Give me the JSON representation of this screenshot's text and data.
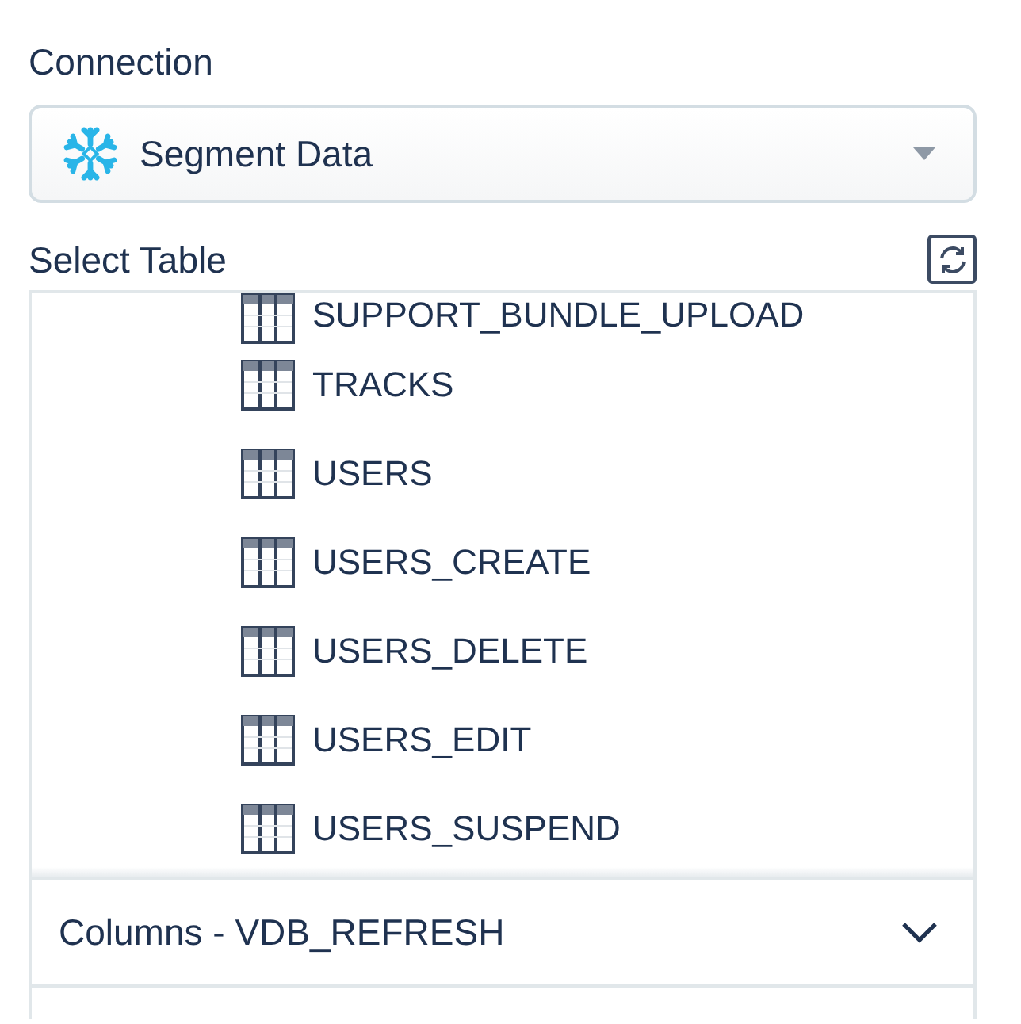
{
  "connection": {
    "label": "Connection",
    "value": "Segment Data"
  },
  "select_table": {
    "label": "Select Table",
    "tables": [
      {
        "name": "SUPPORT_BUNDLE_UPLOAD"
      },
      {
        "name": "TRACKS"
      },
      {
        "name": "USERS"
      },
      {
        "name": "USERS_CREATE"
      },
      {
        "name": "USERS_DELETE"
      },
      {
        "name": "USERS_EDIT"
      },
      {
        "name": "USERS_SUSPEND"
      }
    ]
  },
  "columns_panel": {
    "title": "Columns - VDB_REFRESH",
    "expanded": false
  }
}
